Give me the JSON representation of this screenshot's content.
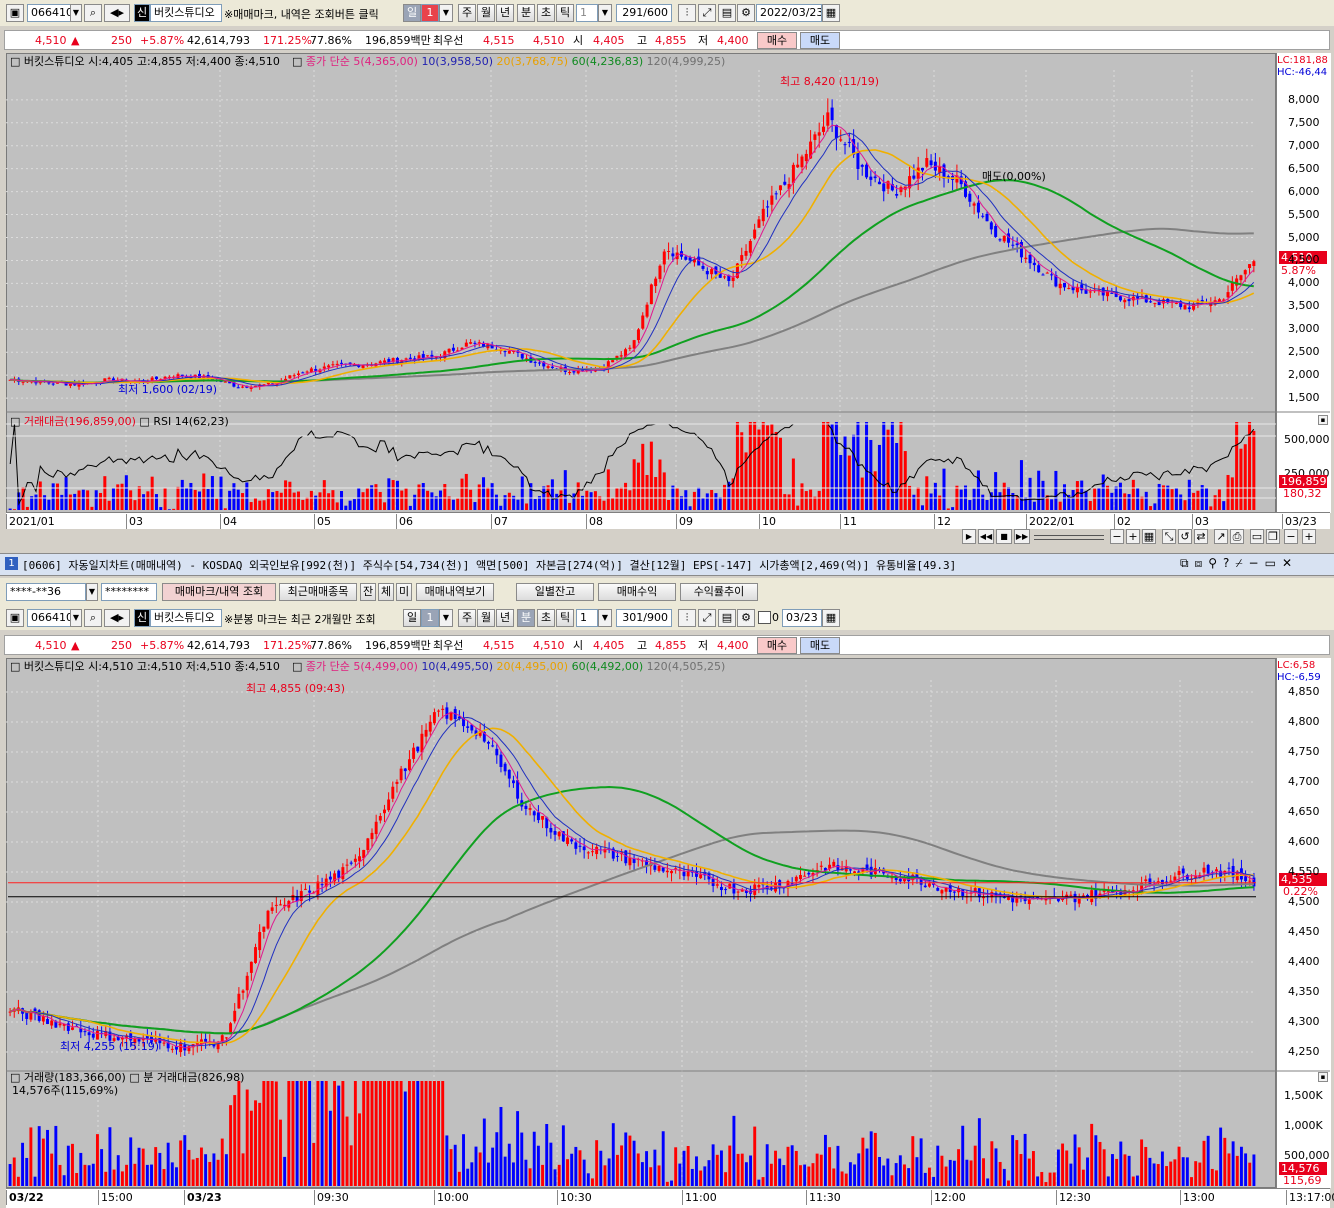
{
  "top": {
    "toolbar": {
      "code": "066410",
      "badge": "신",
      "name": "버킷스튜디오",
      "notice": "※매매마크, 내역은 조회버튼 클릭",
      "period_tabs": [
        "일",
        "1",
        "주",
        "월",
        "년",
        "분",
        "초",
        "틱"
      ],
      "selected": "일",
      "interval": "1",
      "count": "291",
      "total": "/600",
      "date": "2022/03/23"
    },
    "quote": {
      "price": "4,510",
      "arrow": "▲",
      "change": "250",
      "pct": "+5.87%",
      "volume": "42,614,793",
      "vol_ratio": "171.25%",
      "turnover": "77.86%",
      "amount": "196,859백만",
      "bid_label": "최우선",
      "bid": "4,515",
      "ask": "4,510",
      "open_label": "시",
      "open": "4,405",
      "high_label": "고",
      "high": "4,855",
      "low_label": "저",
      "low": "4,400",
      "buy": "매수",
      "sell": "매도"
    },
    "legend": {
      "info": "버킷스튜디오 시:4,405 고:4,855 저:4,400 종:4,510",
      "ma_title": "종가 단순 5(4,365,00)",
      "ma10": "10(3,958,50)",
      "ma20": "20(3,768,75)",
      "ma60": "60(4,236,83)",
      "ma120": "120(4,999,25)",
      "lc": "LC:181,88",
      "hc": "HC:-46,44"
    },
    "high_note": "최고 8,420 (11/19)",
    "low_note": "최저 1,600 (02/19)",
    "mark_note": "매도(0,00%)",
    "price_tag": "4,510",
    "pct_tag": "5.87%",
    "y_ticks": [
      "8,000",
      "7,500",
      "7,000",
      "6,500",
      "6,000",
      "5,500",
      "5,000",
      "4,500",
      "4,000",
      "3,500",
      "3,000",
      "2,500",
      "2,000",
      "1,500"
    ],
    "sub_legend": {
      "amount": "거래대금(196,859,00)",
      "rsi": "RSI 14(62,23)"
    },
    "sub_ticks": [
      "500,000",
      "250,000"
    ],
    "sub_tag1": "196,859",
    "sub_tag2": "180,32",
    "dates": [
      "2021/01",
      "03",
      "04",
      "05",
      "06",
      "07",
      "08",
      "09",
      "10",
      "11",
      "12",
      "2022/01",
      "02",
      "03",
      "03/23"
    ]
  },
  "window2": {
    "title": "[0606] 자동일지차트(매매내역) - KOSDAQ 외국인보유[992(천)] 주식수[54,734(천)] 액면[500] 자본금[274(억)] 결산[12월] EPS[-147] 시가총액[2,469(억)] 유통비율[49.3]",
    "num": "1",
    "account": "****-**36",
    "password": "********",
    "buttons": [
      "매매마크/내역 조회",
      "최근매매종목",
      "잔",
      "체",
      "미",
      "매매내역보기",
      "일별잔고",
      "매매수익",
      "수익률추이"
    ]
  },
  "bottom": {
    "toolbar": {
      "code": "066410",
      "badge": "신",
      "name": "버킷스튜디오",
      "notice": "※분봉 마크는 최근 2개월만 조회",
      "period_tabs": [
        "일",
        "1",
        "주",
        "월",
        "년",
        "분",
        "초",
        "틱"
      ],
      "selected": "분",
      "interval": "1",
      "count": "301",
      "total": "/900",
      "check": "0",
      "date": "03/23"
    },
    "quote": {
      "price": "4,510",
      "arrow": "▲",
      "change": "250",
      "pct": "+5.87%",
      "volume": "42,614,793",
      "vol_ratio": "171.25%",
      "turnover": "77.86%",
      "amount": "196,859백만",
      "bid_label": "최우선",
      "bid": "4,515",
      "ask": "4,510",
      "open_label": "시",
      "open": "4,405",
      "high_label": "고",
      "high": "4,855",
      "low_label": "저",
      "low": "4,400",
      "buy": "매수",
      "sell": "매도"
    },
    "legend": {
      "info": "버킷스튜디오 시:4,510 고:4,510 저:4,510 종:4,510",
      "ma_title": "종가 단순 5(4,499,00)",
      "ma10": "10(4,495,50)",
      "ma20": "20(4,495,00)",
      "ma60": "60(4,492,00)",
      "ma120": "120(4,505,25)",
      "lc": "LC:6,58",
      "hc": "HC:-6,59"
    },
    "high_note": "최고 4,855 (09:43)",
    "low_note": "최저 4,255 (15:19)",
    "price_tag": "4,535",
    "pct_tag": "0.22%",
    "y_ticks": [
      "4,850",
      "4,800",
      "4,750",
      "4,700",
      "4,650",
      "4,600",
      "4,550",
      "4,500",
      "4,450",
      "4,400",
      "4,350",
      "4,300",
      "4,250"
    ],
    "vol_legend": {
      "volume": "거래량(183,366,00)",
      "amount": "분 거래대금(826,98)",
      "sub": "14,576주(115,69%)"
    },
    "vol_ticks": [
      "1,500K",
      "1,000K",
      "500,000"
    ],
    "vol_tag1": "14,576",
    "vol_tag2": "115,69",
    "times": [
      "03/22",
      "15:00",
      "03/23",
      "09:30",
      "10:00",
      "10:30",
      "11:00",
      "11:30",
      "12:00",
      "12:30",
      "13:00",
      "13:17:00"
    ]
  },
  "chart_data": [
    {
      "type": "candlestick",
      "title": "버킷스튜디오 일봉",
      "x": [
        "2021/01",
        "03",
        "04",
        "05",
        "06",
        "07",
        "08",
        "09",
        "10",
        "11",
        "12",
        "2022/01",
        "02",
        "03",
        "03/23"
      ],
      "close_approx": [
        1900,
        1850,
        2000,
        1800,
        2200,
        2350,
        2600,
        2150,
        4800,
        7200,
        6200,
        4300,
        3800,
        3600,
        4510
      ],
      "ylim": [
        1500,
        8400
      ],
      "high": 8420,
      "low": 1600
    },
    {
      "type": "candlestick",
      "title": "버킷스튜디오 1분봉",
      "x": [
        "03/22",
        "15:00",
        "03/23",
        "09:30",
        "10:00",
        "10:30",
        "11:00",
        "11:30",
        "12:00",
        "12:30",
        "13:00",
        "13:17:00"
      ],
      "close_approx": [
        4320,
        4280,
        4270,
        4500,
        4760,
        4600,
        4530,
        4570,
        4540,
        4510,
        4520,
        4535
      ],
      "ylim": [
        4250,
        4855
      ],
      "high": 4855,
      "low": 4255
    }
  ]
}
